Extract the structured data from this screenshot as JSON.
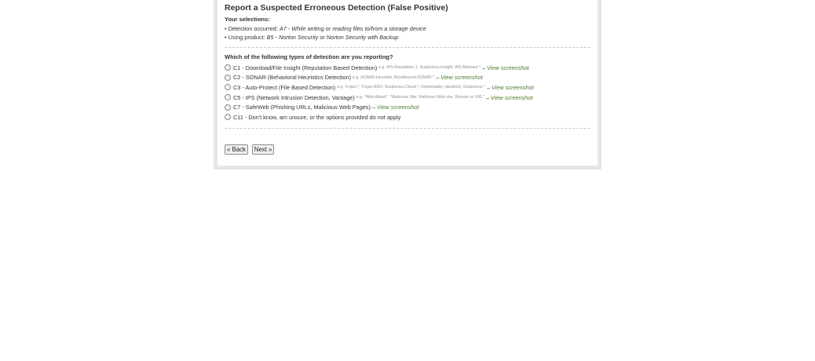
{
  "form": {
    "title": "Report a Suspected Erroneous Detection (False Positive)",
    "selections_label": "Your selections:",
    "selections": [
      {
        "prefix": "• Detection occurred: ",
        "value": "A7 - While writing or reading files to/from a storage device"
      },
      {
        "prefix": "• Using product: ",
        "value": "B5 - Norton Security or Norton Security with Backup"
      }
    ],
    "question": "Which of the following types of detection are you reporting?",
    "options": [
      {
        "label": "C1 - Download/File Insight (Reputation Based Detection)",
        "example": "e.g. WS.Reputation.1, Suspicious.Insight, WS.Malware.*",
        "sep": "–",
        "link": "View screenshot"
      },
      {
        "label": "C2 - SONAR (Behavioral Heuristics Detection)",
        "example": "e.g. SONAR.Heuristic, Bloodhound.SONAR.*",
        "sep": "–",
        "link": "View screenshot"
      },
      {
        "label": "C3 - Auto-Protect (File Based Detection)",
        "example": "e.g. Trojan.*, Trojan.ADH, Suspicious.Cloud.*, Downloader, Hacktool, Suspicious.*",
        "sep": "–",
        "link": "View screenshot"
      },
      {
        "label": "C5 - IPS (Network Intrusion Detection, Vantage)",
        "example": "e.g. \"Web Attack\", \"Malicious Site: Malicious Web site, Domain or URL\"",
        "sep": "–",
        "link": "View screenshot"
      },
      {
        "label": "C7 - SafeWeb (Phishing URLs, Malicious Web Pages)",
        "example": "",
        "sep": "–",
        "link": "View screenshot"
      },
      {
        "label": "C11 - Don't know, am unsure, or the options provided do not apply",
        "example": "",
        "sep": "",
        "link": ""
      }
    ],
    "back_label": "« Back",
    "next_label": "Next »"
  },
  "colors": {
    "panel_border": "#e6e6e6",
    "link": "#4b7a2c",
    "example_text": "#8f8f8f"
  }
}
